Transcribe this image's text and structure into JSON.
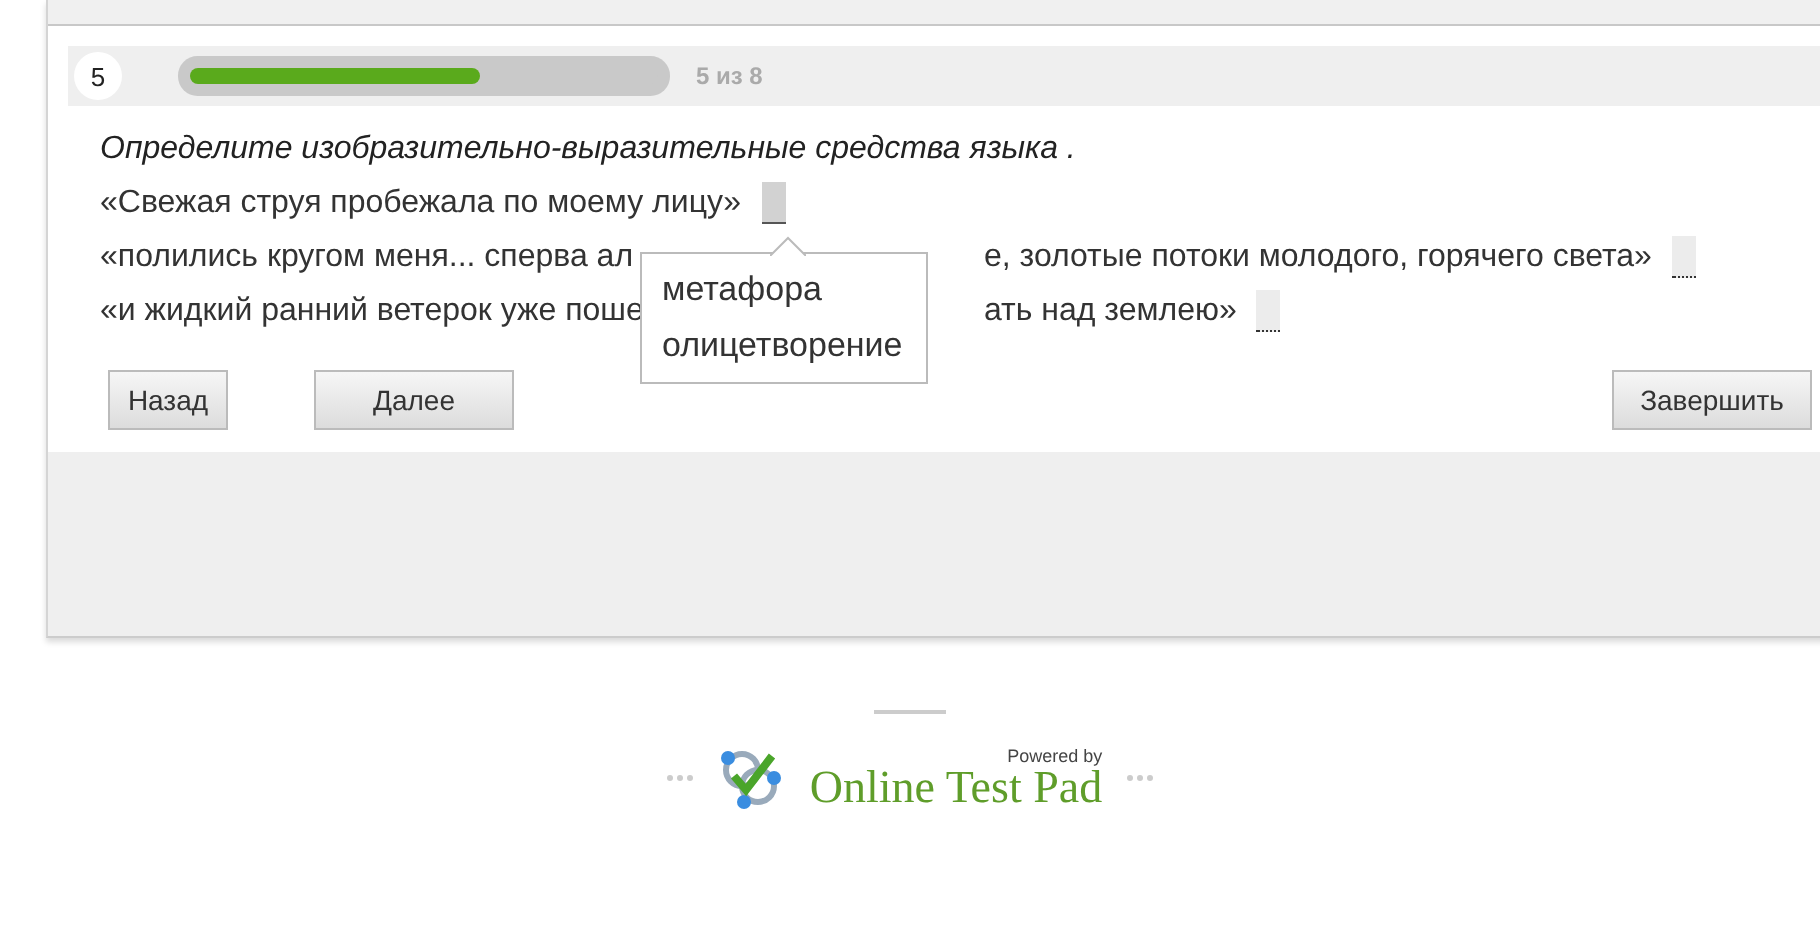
{
  "progress": {
    "number": "5",
    "level": 0.62,
    "label": "5 из 8"
  },
  "question": {
    "title": "Определите изобразительно-выразительные средства языка .",
    "lines": [
      {
        "before": "«Свежая струя пробежала по моему лицу»",
        "blank": {
          "open": true
        }
      },
      {
        "before": "«полились кругом меня... сперва ал",
        "after": "е, золотые потоки молодого, горячего света»",
        "blank": {
          "open": false
        }
      },
      {
        "before": "«и жидкий ранний ветерок уже поше",
        "after": "ать над землею»",
        "blank": {
          "open": false
        }
      }
    ],
    "options": [
      "метафора",
      "олицетворение"
    ]
  },
  "buttons": {
    "back": "Назад",
    "next": "Далее",
    "finish": "Завершить"
  },
  "footer": {
    "powered_by": "Powered by",
    "brand": "Online Test Pad"
  }
}
